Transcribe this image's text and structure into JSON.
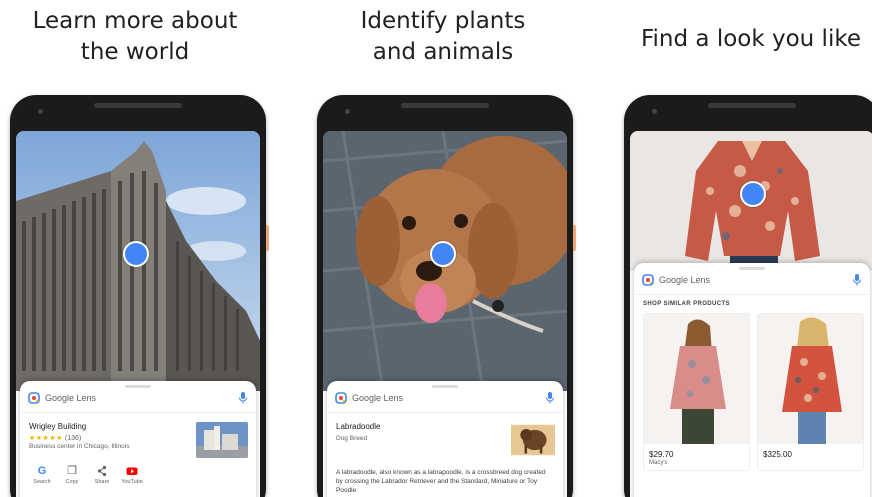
{
  "panels": [
    {
      "headline_line1": "Learn more about",
      "headline_line2": "the world",
      "lens_name": "Google Lens",
      "result_title": "Wrigley Building",
      "rating_stars": "★★★★★",
      "rating_count": "(136)",
      "result_subtitle": "Business center in Chicago, Illinois",
      "actions": [
        {
          "label": "Search",
          "icon": "google-g-icon",
          "glyph": "G",
          "color": "#4285f4"
        },
        {
          "label": "Copy",
          "icon": "copy-icon",
          "glyph": "❐",
          "color": "#5f6368"
        },
        {
          "label": "Share",
          "icon": "share-icon",
          "glyph": "<",
          "color": "#5f6368"
        },
        {
          "label": "YouTube",
          "icon": "youtube-icon",
          "glyph": "▶",
          "color": "#ff0000"
        }
      ]
    },
    {
      "headline_line1": "Identify plants",
      "headline_line2": "and animals",
      "lens_name": "Google Lens",
      "result_title": "Labradoodle",
      "result_subtitle": "Dog Breed",
      "description": "A labradoodle, also known as a labrapoodle, is a crossbreed dog created by crossing the Labrador Retriever and the Standard, Miniature or Toy Poodle"
    },
    {
      "headline_line1": "Find a look you like",
      "lens_name": "Google Lens",
      "section_heading": "SHOP SIMILAR PRODUCTS",
      "products": [
        {
          "price": "$29.70",
          "store": "Macy's"
        },
        {
          "price": "$325.00",
          "store": ""
        }
      ]
    }
  ],
  "colors": {
    "accent_blue": "#4285f4",
    "star_yellow": "#f4b400",
    "phone_body": "#1b1b1b"
  }
}
